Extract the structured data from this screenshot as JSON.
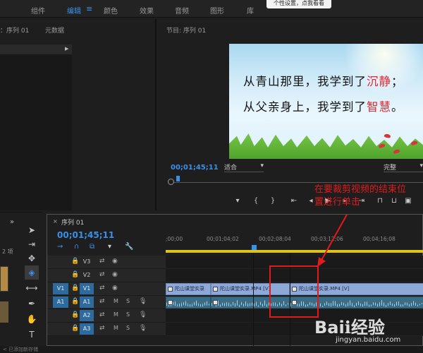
{
  "workspace_bar": {
    "items": [
      "组件",
      "编辑",
      "颜色",
      "效果",
      "音频",
      "图形",
      "库"
    ],
    "active": "编辑",
    "active_menu_icon": "hamburger-icon",
    "tooltip": "个性设置，点我看看"
  },
  "source_panel": {
    "tab": "：序列 01",
    "metadata_tab": "元数据"
  },
  "program_monitor": {
    "title": "节目: 序列 01",
    "timecode": "00;01;45;11",
    "fit": "适合",
    "quality": "完整",
    "video": {
      "line1_pre": "从青山那里，我学到了",
      "line1_hl": "沉静",
      "line1_post": "；",
      "line2_pre": "从父亲身上，我学到了",
      "line2_hl": "智慧",
      "line2_post": "。"
    },
    "transport_buttons": [
      "add-marker-icon",
      "mark-in-icon",
      "mark-out-icon",
      "go-to-in-icon",
      "step-back-icon",
      "play-icon",
      "step-forward-icon",
      "go-to-out-icon",
      "lift-icon",
      "extract-icon",
      "export-frame-icon"
    ]
  },
  "left": {
    "item_count": "2 项",
    "collapse": "»"
  },
  "tools": [
    "selection-tool-icon",
    "track-select-icon",
    "ripple-edit-icon",
    "razor-tool-icon",
    "slip-tool-icon",
    "pen-tool-icon",
    "hand-tool-icon",
    "type-tool-icon"
  ],
  "timeline": {
    "tab": "序列 01",
    "timecode": "00;01;45;11",
    "ruler_ticks": [
      ";00;00",
      "00;01;04;02",
      "00;02;08;04",
      "00;03;12;06",
      "00;04;16;08"
    ],
    "tracks": {
      "v3": "V3",
      "v2": "V2",
      "v1": "V1",
      "a1": "A1",
      "a2": "A2",
      "a3": "A3",
      "src_v": "V1",
      "src_a": "A1",
      "mute": "M",
      "solo": "S"
    },
    "clips": {
      "clip1": "陀山课堂实录",
      "clip2": "陀山课堂实录.MP4 [V]",
      "clip3": "陀山课堂实录.MP4 [V]"
    }
  },
  "annotation": {
    "text": "在要裁剪视频的结束位置进行单击",
    "color": "#e11b1b"
  },
  "bottom": {
    "status": "< 已添加新存储"
  },
  "watermark": {
    "logo": "Baiℹ经验",
    "url": "jingyan.baidu.com"
  },
  "colors": {
    "accent": "#3b8fe8",
    "ruler": "#e0c21c",
    "video_clip": "#8ea9d8",
    "audio_clip": "#3b6d86",
    "highlight_red": "#e2262f"
  }
}
